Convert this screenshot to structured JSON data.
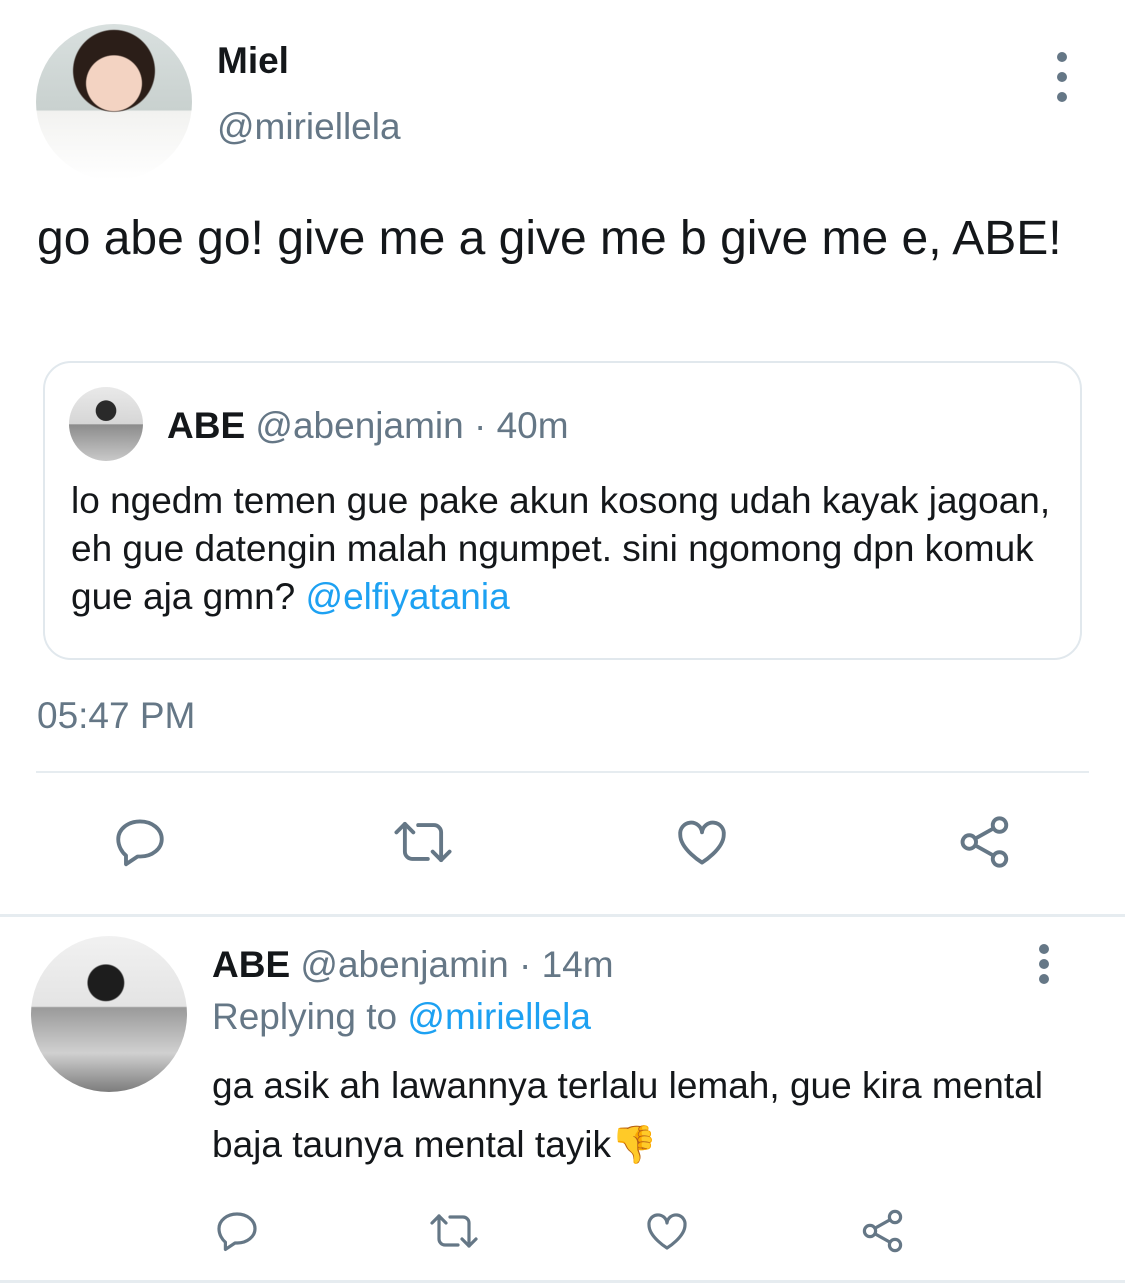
{
  "main_tweet": {
    "author_name": "Miel",
    "author_handle": "@miriellela",
    "text": "go abe go! give me a give me b give me e, ABE!",
    "time": "05:47 PM"
  },
  "quoted_tweet": {
    "author_name": "ABE",
    "author_handle": "@abenjamin",
    "separator": " · ",
    "age": "40m",
    "text": "lo ngedm temen gue pake akun kosong udah kayak jagoan, eh gue datengin malah ngumpet. sini ngomong dpn komuk gue aja gmn? ",
    "mention": "@elfiyatania"
  },
  "reply_tweet": {
    "author_name": "ABE",
    "author_handle": "@abenjamin",
    "separator": " · ",
    "age": "14m",
    "replying_prefix": "Replying to ",
    "replying_to": "@miriellela",
    "text": "ga asik ah lawannya terlalu lemah, gue kira mental baja taunya mental tayik",
    "emoji": "👎"
  },
  "icons": {
    "reply": "reply-icon",
    "retweet": "retweet-icon",
    "like": "heart-icon",
    "share": "share-icon",
    "more": "more-vertical-icon"
  },
  "colors": {
    "text": "#14171a",
    "muted": "#657786",
    "link": "#1da1f2",
    "divider": "#e6ecf0"
  }
}
